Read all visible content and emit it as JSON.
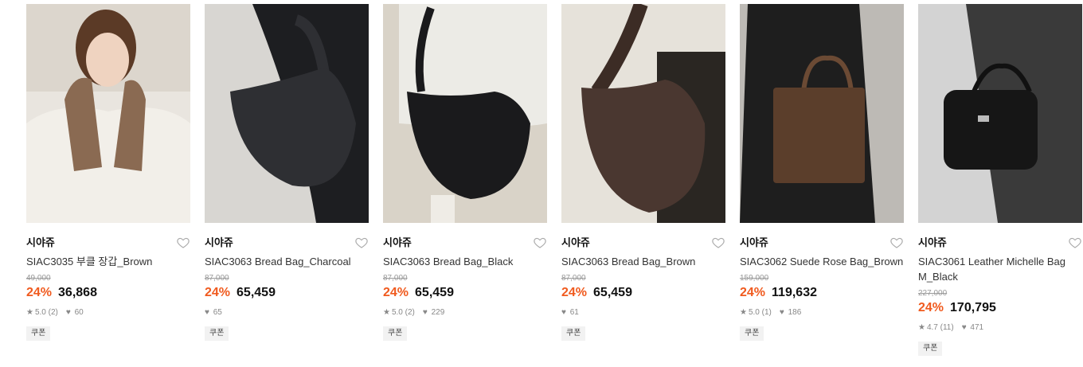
{
  "products": [
    {
      "brand": "시야쥬",
      "name": "SIAC3035 부클 장갑_Brown",
      "original_price": "49,000",
      "discount": "24%",
      "price": "36,868",
      "rating": "5.0",
      "reviews": "(2)",
      "likes": "60",
      "coupon": "쿠폰",
      "colors": {
        "bg": "#e9e5df",
        "item": "#8a6a52"
      }
    },
    {
      "brand": "시야쥬",
      "name": "SIAC3063 Bread Bag_Charcoal",
      "original_price": "87,000",
      "discount": "24%",
      "price": "65,459",
      "rating": null,
      "reviews": null,
      "likes": "65",
      "coupon": "쿠폰",
      "colors": {
        "bg": "#d8d6d2",
        "item": "#2e2f33"
      }
    },
    {
      "brand": "시야쥬",
      "name": "SIAC3063 Bread Bag_Black",
      "original_price": "87,000",
      "discount": "24%",
      "price": "65,459",
      "rating": "5.0",
      "reviews": "(2)",
      "likes": "229",
      "coupon": "쿠폰",
      "colors": {
        "bg": "#d9d3c8",
        "item": "#1a1a1c"
      }
    },
    {
      "brand": "시야쥬",
      "name": "SIAC3063 Bread Bag_Brown",
      "original_price": "87,000",
      "discount": "24%",
      "price": "65,459",
      "rating": null,
      "reviews": null,
      "likes": "61",
      "coupon": "쿠폰",
      "colors": {
        "bg": "#e6e2da",
        "item": "#4a3730"
      }
    },
    {
      "brand": "시야쥬",
      "name": "SIAC3062 Suede Rose Bag_Brown",
      "original_price": "159,000",
      "discount": "24%",
      "price": "119,632",
      "rating": "5.0",
      "reviews": "(1)",
      "likes": "186",
      "coupon": "쿠폰",
      "colors": {
        "bg": "#bdbab5",
        "item": "#5b3e2b"
      }
    },
    {
      "brand": "시야쥬",
      "name": "SIAC3061 Leather Michelle Bag M_Black",
      "original_price": "227,000",
      "discount": "24%",
      "price": "170,795",
      "rating": "4.7",
      "reviews": "(11)",
      "likes": "471",
      "coupon": "쿠폰",
      "colors": {
        "bg": "#d3d3d3",
        "item": "#161616"
      }
    }
  ],
  "icons": {
    "heart": "heart-outline-icon",
    "star": "star-icon",
    "like": "heart-filled-icon"
  },
  "accent_color": "#f05a1e"
}
